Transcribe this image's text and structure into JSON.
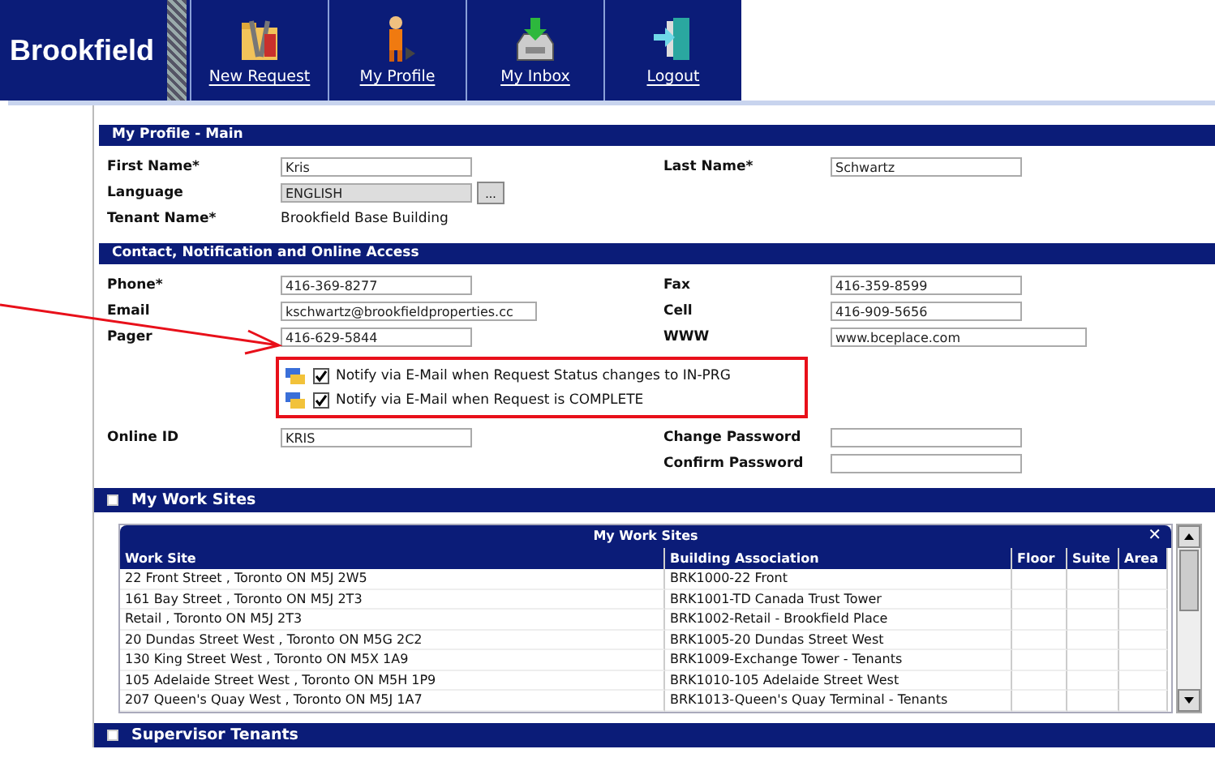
{
  "logo": "Brookfield",
  "nav": [
    {
      "label": "New Request"
    },
    {
      "label": "My Profile"
    },
    {
      "label": "My Inbox"
    },
    {
      "label": "Logout"
    }
  ],
  "profile": {
    "title": "My Profile - Main",
    "rows": [
      {
        "label": "First Name*",
        "kind": "input",
        "value": "Kris",
        "right_label": "Last Name*",
        "right_value": "Schwartz"
      },
      {
        "label": "Language",
        "kind": "lookup",
        "value": "ENGLISH",
        "button": "..."
      },
      {
        "label": "Tenant Name*",
        "kind": "text",
        "value": "Brookfield Base Building"
      }
    ]
  },
  "contact": {
    "title": "Contact, Notification and Online Access",
    "rows": [
      {
        "label": "Phone*",
        "value": "416-369-8277",
        "right_label": "Fax",
        "right_value": "416-359-8599"
      },
      {
        "label": "Email",
        "value": "kschwartz@brookfieldproperties.cc",
        "right_label": "Cell",
        "right_value": "416-909-5656"
      },
      {
        "label": "Pager",
        "value": "416-629-5844",
        "right_label": "WWW",
        "right_value": "www.bceplace.com"
      }
    ],
    "notifications": [
      {
        "label": "Notify via E-Mail when Request Status changes to IN-PRG",
        "checked": true
      },
      {
        "label": "Notify via E-Mail when Request is COMPLETE",
        "checked": true
      }
    ],
    "online_id": {
      "label": "Online ID",
      "value": "KRIS"
    },
    "passwords": [
      {
        "label": "Change Password"
      },
      {
        "label": "Confirm Password"
      }
    ]
  },
  "work_sites": {
    "title": "My Work Sites",
    "table_title": "My Work Sites",
    "close": "✕",
    "columns": [
      "Work Site",
      "Building Association",
      "Floor",
      "Suite",
      "Area"
    ],
    "rows": [
      [
        "22 Front Street , Toronto ON M5J 2W5",
        "BRK1000-22 Front"
      ],
      [
        "161 Bay Street , Toronto ON M5J 2T3",
        "BRK1001-TD Canada Trust Tower"
      ],
      [
        "Retail , Toronto ON M5J 2T3",
        "BRK1002-Retail - Brookfield Place"
      ],
      [
        "20 Dundas Street West , Toronto ON M5G 2C2",
        "BRK1005-20 Dundas Street West"
      ],
      [
        "130 King Street West , Toronto ON M5X 1A9",
        "BRK1009-Exchange Tower - Tenants"
      ],
      [
        "105 Adelaide Street West , Toronto ON M5H 1P9",
        "BRK1010-105 Adelaide Street West"
      ],
      [
        "207 Queen's Quay West , Toronto ON M5J 1A7",
        "BRK1013-Queen's Quay Terminal - Tenants"
      ]
    ]
  },
  "supervisor": {
    "title": "Supervisor Tenants"
  }
}
